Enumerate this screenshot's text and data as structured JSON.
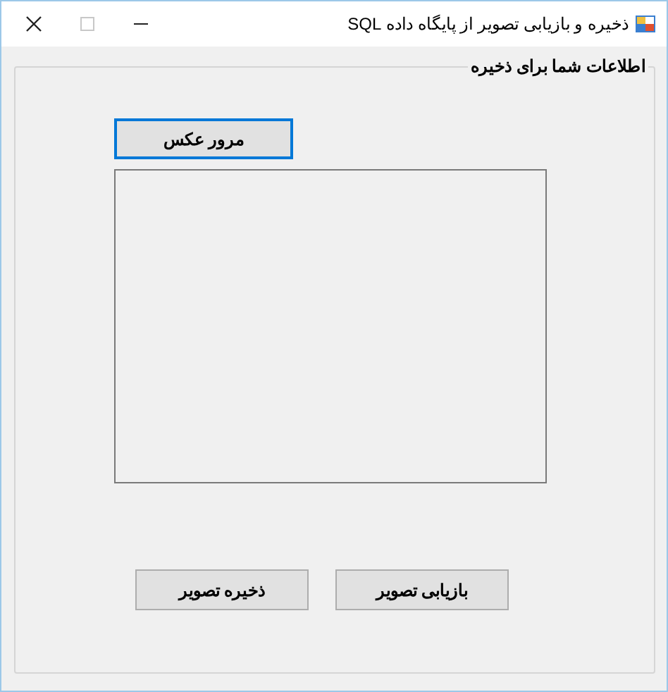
{
  "window": {
    "title": "ذخیره و بازیابی تصویر از پایگاه داده SQL"
  },
  "group": {
    "title": "اطلاعات شما برای ذخیره"
  },
  "browse_button": {
    "label": "مرور عکس",
    "focused": true
  },
  "picture_box": {
    "kind": "empty"
  },
  "buttons": [
    {
      "label": "بازیابی تصویر"
    },
    {
      "label": "ذخیره تصویر"
    }
  ]
}
